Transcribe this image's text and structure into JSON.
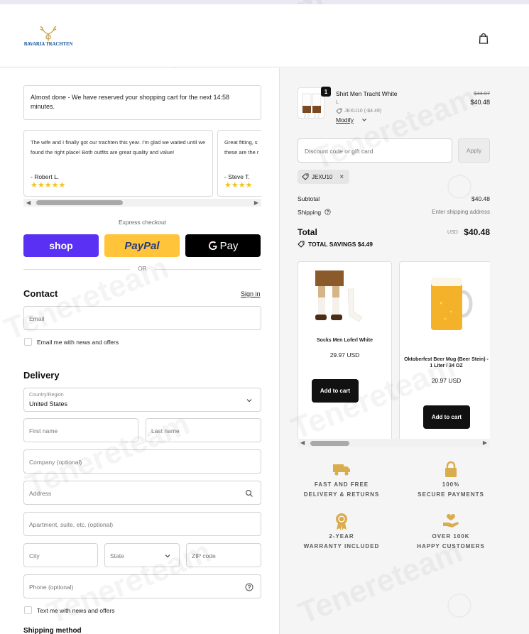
{
  "brand": {
    "logo_text": "BAVARIA TRACHTEN"
  },
  "left": {
    "reservation": "Almost done - We have reserved your shopping cart for the next 14:58 minutes.",
    "reviews": [
      {
        "text": "The wife and I finally got our trachten this year. I'm glad we waited until we found the right place! Both outfits are great quality and value!",
        "author": "- Robert L.",
        "stars": "★★★★★"
      },
      {
        "text": "Great fitting, s these are the r",
        "author": "- Steve T.",
        "stars": "★★★★"
      }
    ],
    "express_label": "Express checkout",
    "pay_buttons": {
      "shop": "shop",
      "paypal": "PayPal",
      "gpay": "Pay"
    },
    "or": "OR",
    "contact": {
      "heading": "Contact",
      "signin": "Sign in",
      "email_placeholder": "Email",
      "newsletter_label": "Email me with news and offers"
    },
    "delivery": {
      "heading": "Delivery",
      "country_label": "Country/Region",
      "country_value": "United States",
      "first_name": "First name",
      "last_name": "Last name",
      "company": "Company (optional)",
      "address": "Address",
      "apartment": "Apartment, suite, etc. (optional)",
      "city": "City",
      "state": "State",
      "zip": "ZIP code",
      "phone": "Phone (optional)",
      "text_me_label": "Text me with news and offers",
      "shipping_method": "Shipping method"
    }
  },
  "cart": {
    "item": {
      "qty": "1",
      "name": "Shirt Men Tracht White",
      "variant": "L",
      "discount": "JEXU10 (-$4.49)",
      "modify": "Modify",
      "old_price": "$44.97",
      "price": "$40.48"
    },
    "discount_placeholder": "Discount code or gift card",
    "apply": "Apply",
    "code_chip": "JEXU10",
    "subtotal_label": "Subtotal",
    "subtotal": "$40.48",
    "shipping_label": "Shipping",
    "shipping_value": "Enter shipping address",
    "total_label": "Total",
    "currency": "USD",
    "total": "$40.48",
    "savings": "TOTAL SAVINGS  $4.49",
    "upsell": [
      {
        "name": "Socks Men Loferl White",
        "price": "29.97 USD",
        "button": "Add to cart"
      },
      {
        "name": "Oktoberfest Beer Mug (Beer Stein) - 1 Liter / 34 OZ",
        "price": "20.97 USD",
        "button": "Add to cart"
      }
    ],
    "features": [
      {
        "line1": "FAST AND FREE",
        "line2": "DELIVERY & RETURNS",
        "icon": "truck-icon"
      },
      {
        "line1": "100%",
        "line2": "SECURE PAYMENTS",
        "icon": "lock-icon"
      },
      {
        "line1": "2-YEAR",
        "line2": "WARRANTY INCLUDED",
        "icon": "award-icon"
      },
      {
        "line1": "OVER 100K",
        "line2": "HAPPY CUSTOMERS",
        "icon": "heart-hand-icon"
      }
    ]
  },
  "colors": {
    "shop": "#5a31f4",
    "paypal": "#ffc439",
    "gold": "#d9ac4e",
    "stars": "#f2c31c"
  }
}
